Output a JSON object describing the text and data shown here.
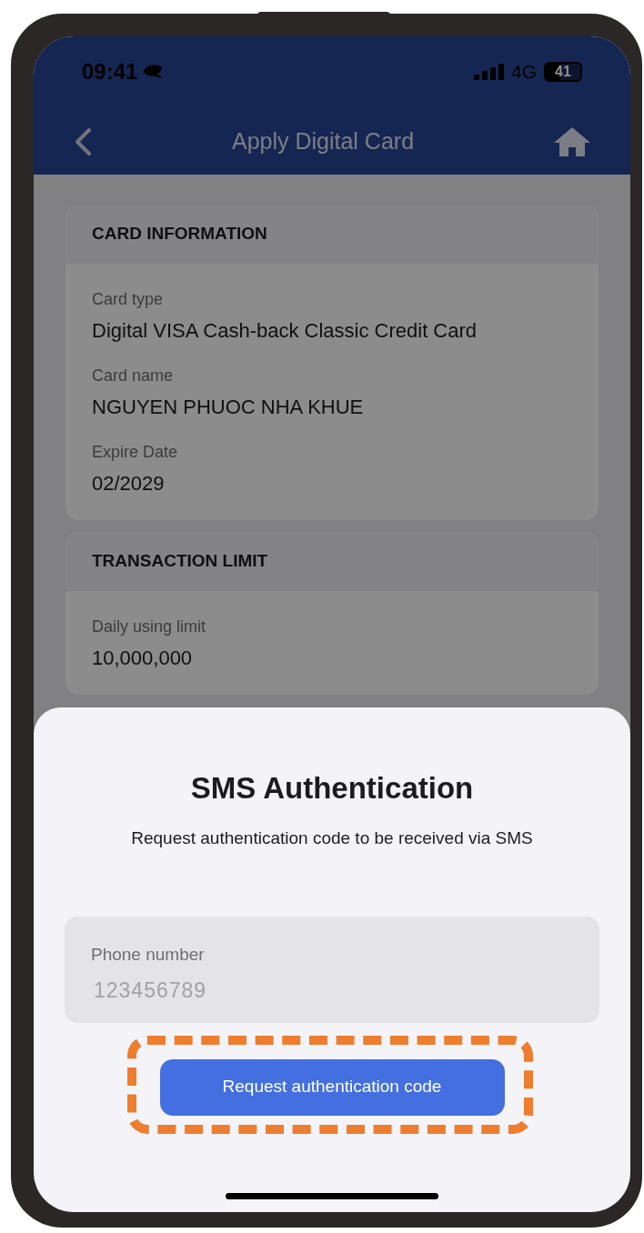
{
  "status_bar": {
    "time": "09:41",
    "network": "4G",
    "battery": "41"
  },
  "nav": {
    "title": "Apply Digital Card"
  },
  "sections": [
    {
      "title": "CARD INFORMATION",
      "fields": [
        {
          "label": "Card type",
          "value": "Digital VISA Cash-back Classic Credit Card"
        },
        {
          "label": "Card name",
          "value": "NGUYEN PHUOC NHA KHUE"
        },
        {
          "label": "Expire Date",
          "value": "02/2029"
        }
      ]
    },
    {
      "title": "TRANSACTION LIMIT",
      "fields": [
        {
          "label": "Daily using limit",
          "value": "10,000,000"
        }
      ]
    }
  ],
  "sheet": {
    "title": "SMS Authentication",
    "description": "Request authentication code to be received via SMS",
    "phone_field": {
      "label": "Phone number",
      "value": "123456789",
      "disabled": true
    },
    "button": "Request authentication code"
  }
}
